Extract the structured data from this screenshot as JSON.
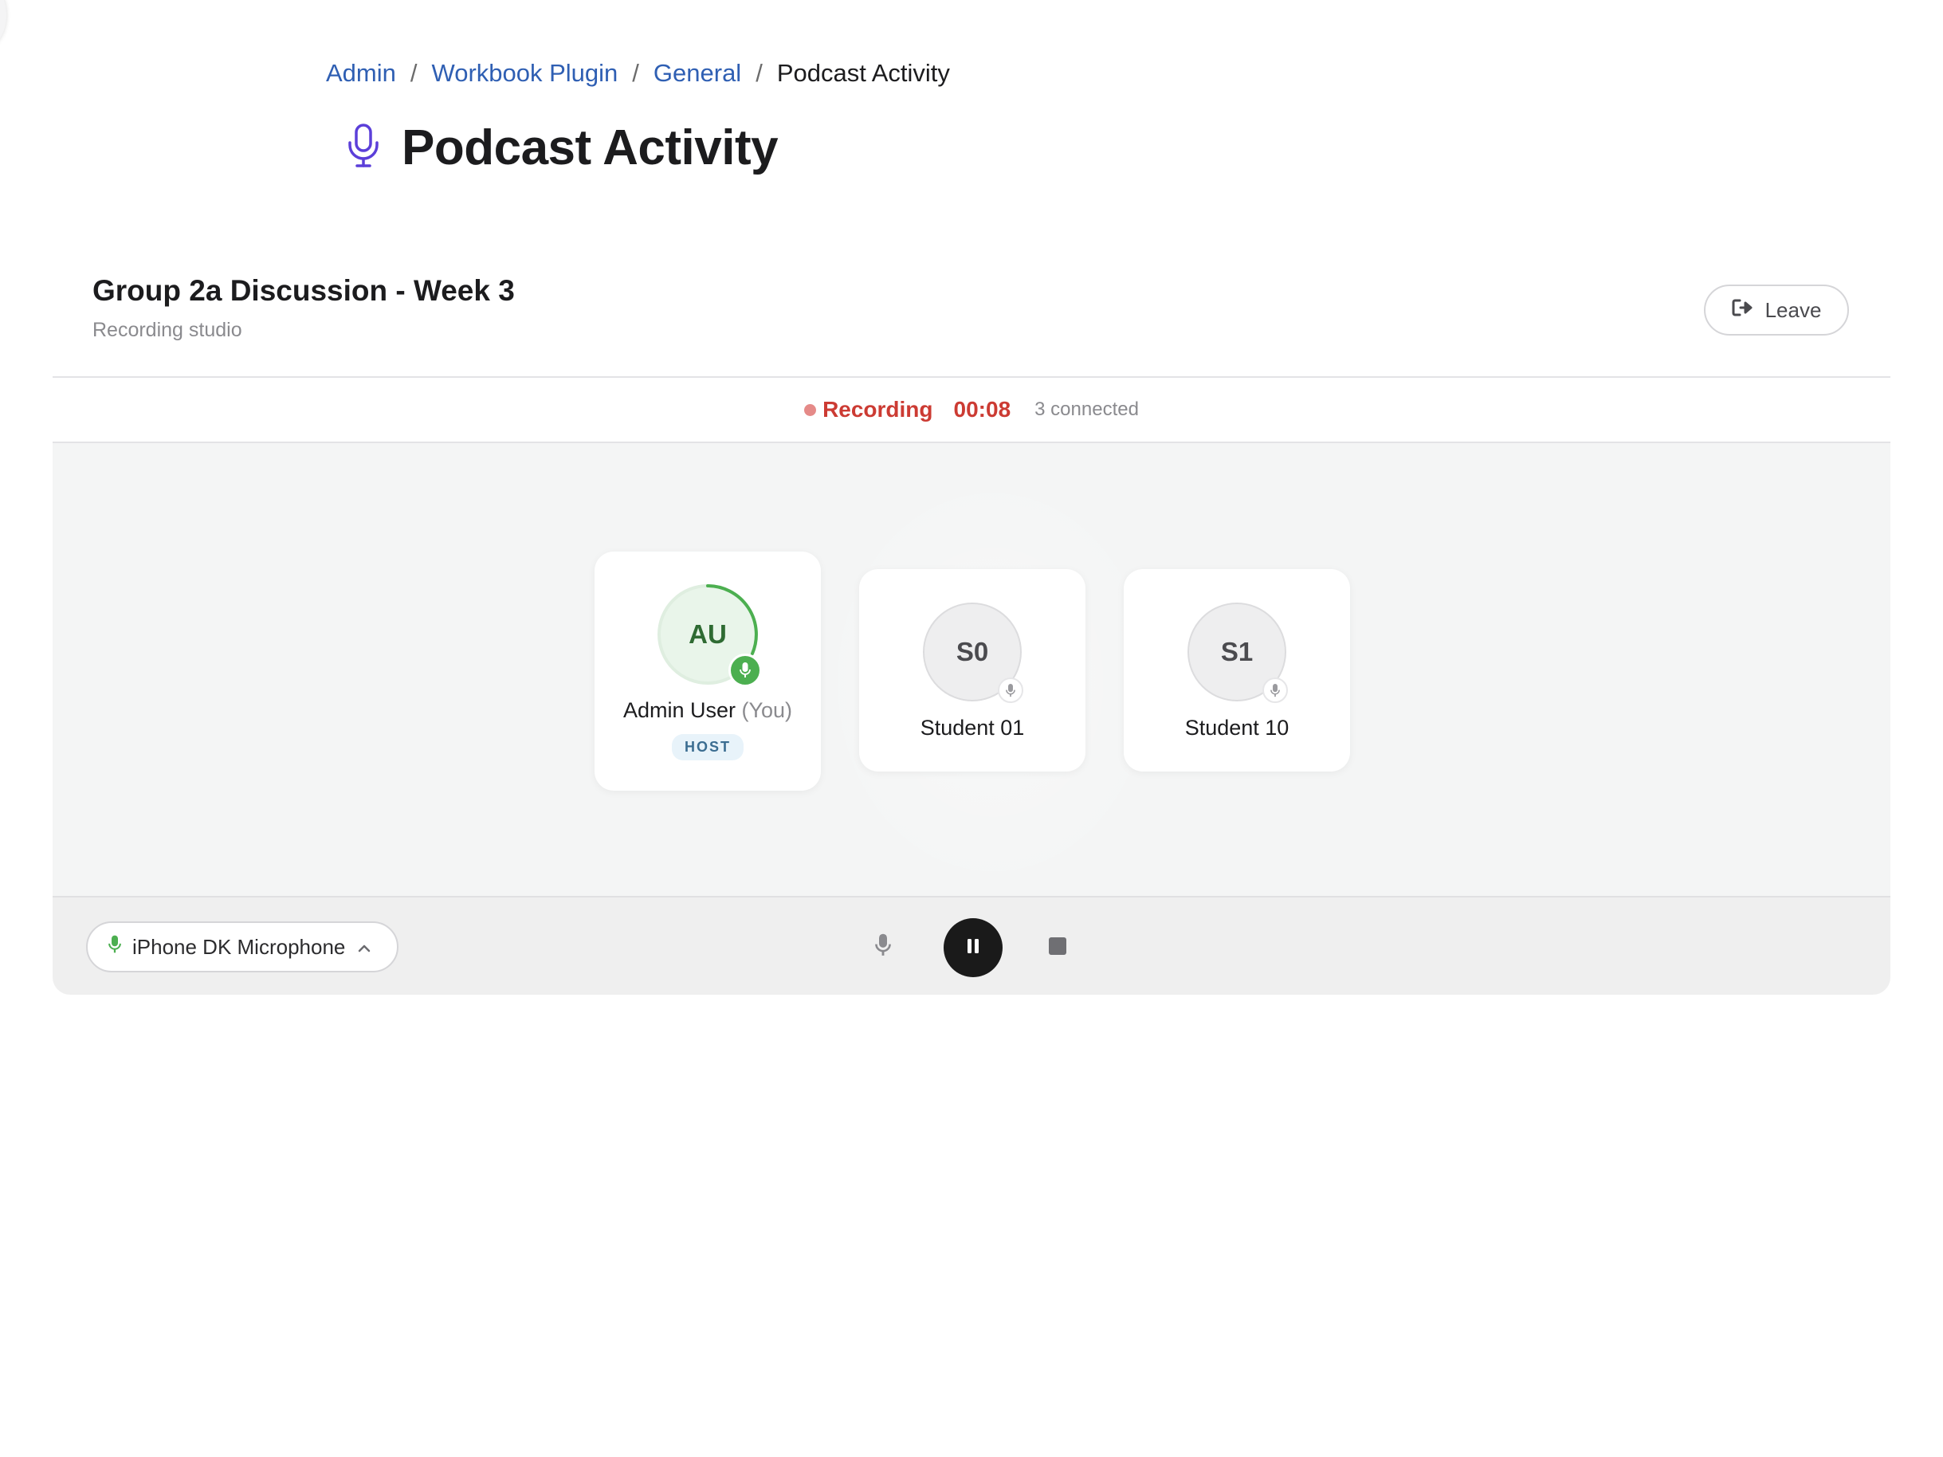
{
  "breadcrumb": {
    "items": [
      "Admin",
      "Workbook Plugin",
      "General"
    ],
    "current": "Podcast Activity",
    "separator": "/"
  },
  "page": {
    "title": "Podcast Activity",
    "icon": "microphone-icon",
    "icon_color": "#5b3fd9"
  },
  "session": {
    "title": "Group 2a Discussion - Week 3",
    "subtitle": "Recording studio",
    "leave_label": "Leave"
  },
  "status": {
    "state": "Recording",
    "timer": "00:08",
    "connected": "3 connected",
    "color": "#cc3b33"
  },
  "participants": [
    {
      "initials": "AU",
      "name": "Admin User",
      "you_tag": "(You)",
      "role_badge": "HOST",
      "mic": "live",
      "speaking": true
    },
    {
      "initials": "S0",
      "name": "Student 01",
      "mic": "idle",
      "speaking": false
    },
    {
      "initials": "S1",
      "name": "Student 10",
      "mic": "idle",
      "speaking": false
    }
  ],
  "controls": {
    "microphone_device": "iPhone DK Microphone",
    "mic_toggle_icon": "microphone-icon",
    "pause_icon": "pause-icon",
    "stop_icon": "stop-icon"
  },
  "colors": {
    "accent_green": "#4caf50",
    "link_blue": "#2f5fb3",
    "recording_red": "#cc3b33"
  }
}
